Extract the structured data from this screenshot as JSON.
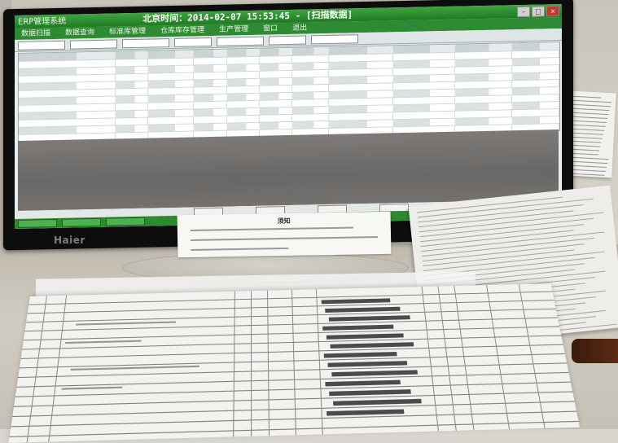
{
  "monitor": {
    "title_app": "ERP管理系统",
    "title_clock": "北京时间：2014-02-07 15:53:45 - [扫描数据]",
    "menu": [
      "数据扫描",
      "数据查询",
      "标准库管理",
      "仓库库存管理",
      "生产管理",
      "窗口",
      "退出"
    ],
    "brand": "Haier"
  },
  "notice": {
    "title": "须知"
  },
  "icons": {
    "window_controls": [
      "minimize-icon",
      "maximize-icon",
      "close-icon"
    ],
    "power": "power-led-icon"
  },
  "colors": {
    "titlebar_green": "#2e8b34",
    "screen_bg": "#e8ecee",
    "bezel": "#0d0d0d",
    "power_led": "#1d5fbf"
  }
}
